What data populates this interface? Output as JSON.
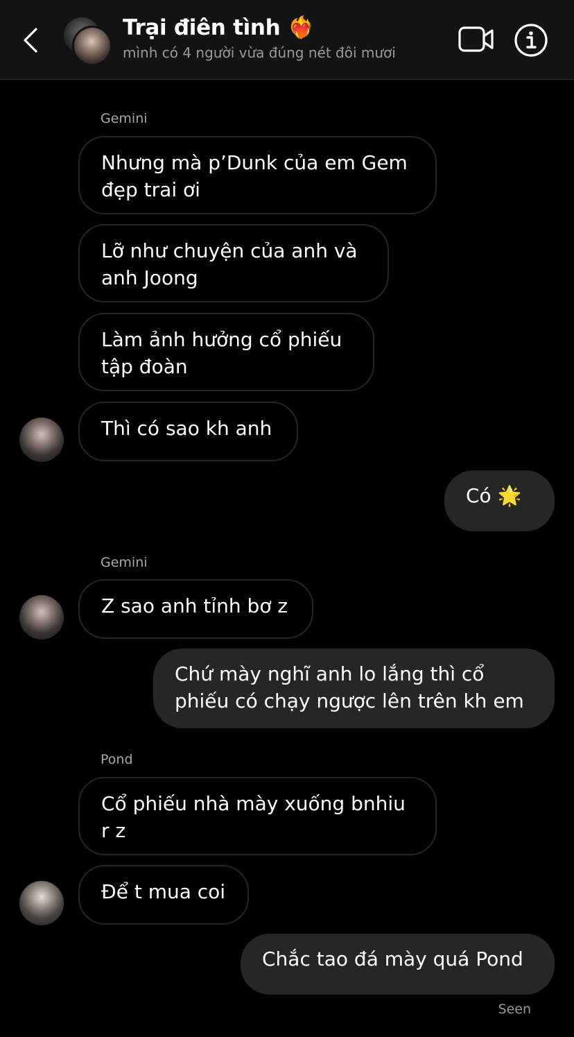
{
  "header": {
    "title": "Trại điên tình ❤️‍🔥",
    "subtitle": "mình có 4 người vừa đúng nét đôi mươi"
  },
  "messages": [
    {
      "sender": "Gemini",
      "text_lines": [
        "Nhưng mà p’Dunk của em Gem",
        "đẹp trai ơi"
      ]
    },
    {
      "text_lines": [
        "Lỡ như chuyện của anh và",
        "anh Joong"
      ]
    },
    {
      "text_lines": [
        "Làm ảnh hưởng cổ phiếu",
        "tập đoàn"
      ]
    },
    {
      "text_lines": [
        "Thì có sao kh anh"
      ]
    },
    {
      "text_lines": [
        "Có 🌟"
      ]
    },
    {
      "sender": "Gemini",
      "text_lines": [
        "Z sao anh tỉnh bơ z"
      ]
    },
    {
      "text_lines": [
        "Chứ mày nghĩ anh lo lắng thì cổ",
        "phiếu có chạy ngược lên trên kh em"
      ]
    },
    {
      "sender": "Pond",
      "text_lines": [
        "Cổ phiếu nhà mày xuống bnhiu",
        "r z"
      ]
    },
    {
      "text_lines": [
        "Để t mua coi"
      ]
    },
    {
      "text_lines": [
        "Chắc tao đá mày quá Pond"
      ]
    }
  ],
  "status": "Seen",
  "colors": {
    "background": "#000000",
    "header_bg": "#131313",
    "outgoing_bubble": "#262626",
    "incoming_border": "#262626",
    "secondary_text": "#a8a8a8"
  }
}
